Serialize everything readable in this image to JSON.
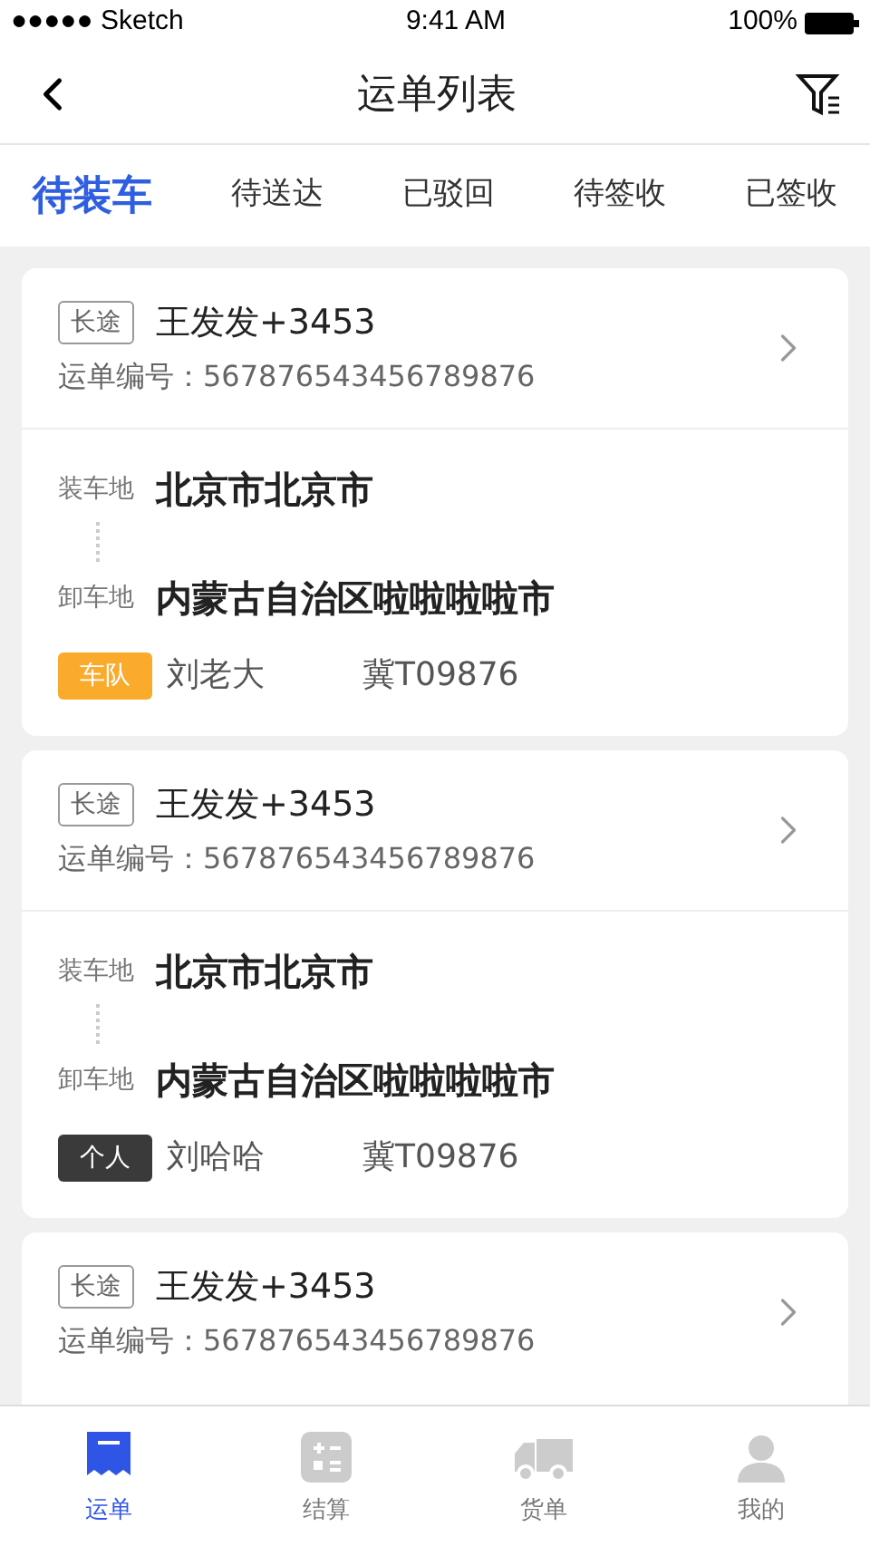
{
  "status_bar": {
    "carrier": "●●●●● Sketch",
    "time": "9:41 AM",
    "battery": "100%"
  },
  "nav": {
    "title": "运单列表"
  },
  "tabs": [
    {
      "label": "待装车",
      "selected": true
    },
    {
      "label": "待送达",
      "selected": false
    },
    {
      "label": "已驳回",
      "selected": false
    },
    {
      "label": "待签收",
      "selected": false
    },
    {
      "label": "已签收",
      "selected": false
    }
  ],
  "orders": [
    {
      "tag": "长途",
      "name": "王发发+3453",
      "number": "运单编号：567876543456789876",
      "load_label": "装车地",
      "load": "北京市北京市",
      "unload_label": "卸车地",
      "unload": "内蒙古自治区啦啦啦啦市",
      "driver_type": "车队",
      "color": "#fbab2c",
      "driver": "刘老大",
      "plate": "冀T09876"
    },
    {
      "tag": "长途",
      "name": "王发发+3453",
      "number": "运单编号：567876543456789876",
      "load_label": "装车地",
      "load": "北京市北京市",
      "unload_label": "卸车地",
      "unload": "内蒙古自治区啦啦啦啦市",
      "driver_type": "个人",
      "color": "#3a3a3a",
      "driver": "刘哈哈",
      "plate": "冀T09876"
    },
    {
      "tag": "长途",
      "name": "王发发+3453",
      "number": "运单编号：567876543456789876"
    }
  ],
  "tab_bar": [
    {
      "label": "运单",
      "kind": "receipt",
      "selected": true
    },
    {
      "label": "结算",
      "kind": "calculator",
      "selected": false
    },
    {
      "label": "货单",
      "kind": "truck",
      "selected": false
    },
    {
      "label": "我的",
      "kind": "person",
      "selected": false
    }
  ]
}
